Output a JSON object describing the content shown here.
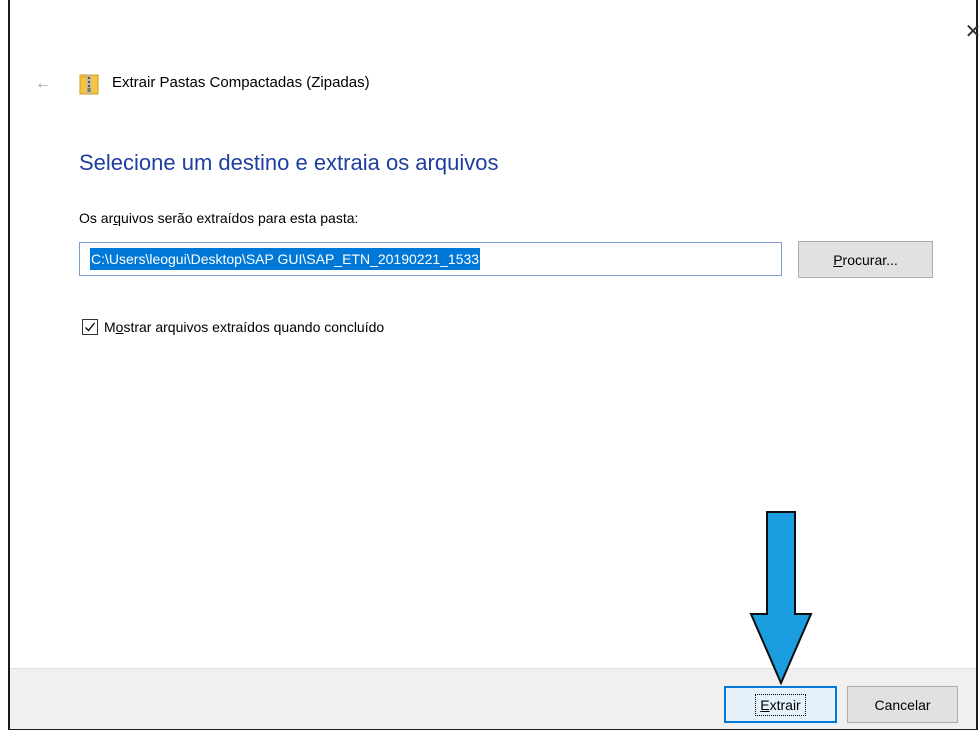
{
  "window": {
    "title": "Extrair Pastas Compactadas (Zipadas)",
    "close_glyph": "✕",
    "back_glyph": "←",
    "icon": "zip-folder-icon"
  },
  "main": {
    "heading": "Selecione um destino e extraia os arquivos",
    "folder_label": {
      "before": "Os ar",
      "accel": "q",
      "after": "uivos serão extraídos para esta pasta:"
    },
    "path_value": "C:\\Users\\leogui\\Desktop\\SAP GUI\\SAP_ETN_20190221_1533",
    "browse_button": {
      "accel": "P",
      "rest": "rocurar..."
    },
    "show_files_checkbox": {
      "checked": true,
      "label_before": "M",
      "accel": "o",
      "label_after": "strar arquivos extraídos quando concluído"
    }
  },
  "footer": {
    "extract_button": {
      "accel": "E",
      "rest": "xtrair"
    },
    "cancel_button": "Cancelar"
  },
  "colors": {
    "heading": "#1f3f9c",
    "selection": "#0078d7",
    "annotation_arrow": "#1a9ee0"
  },
  "annotation": {
    "icon": "down-arrow-icon"
  }
}
